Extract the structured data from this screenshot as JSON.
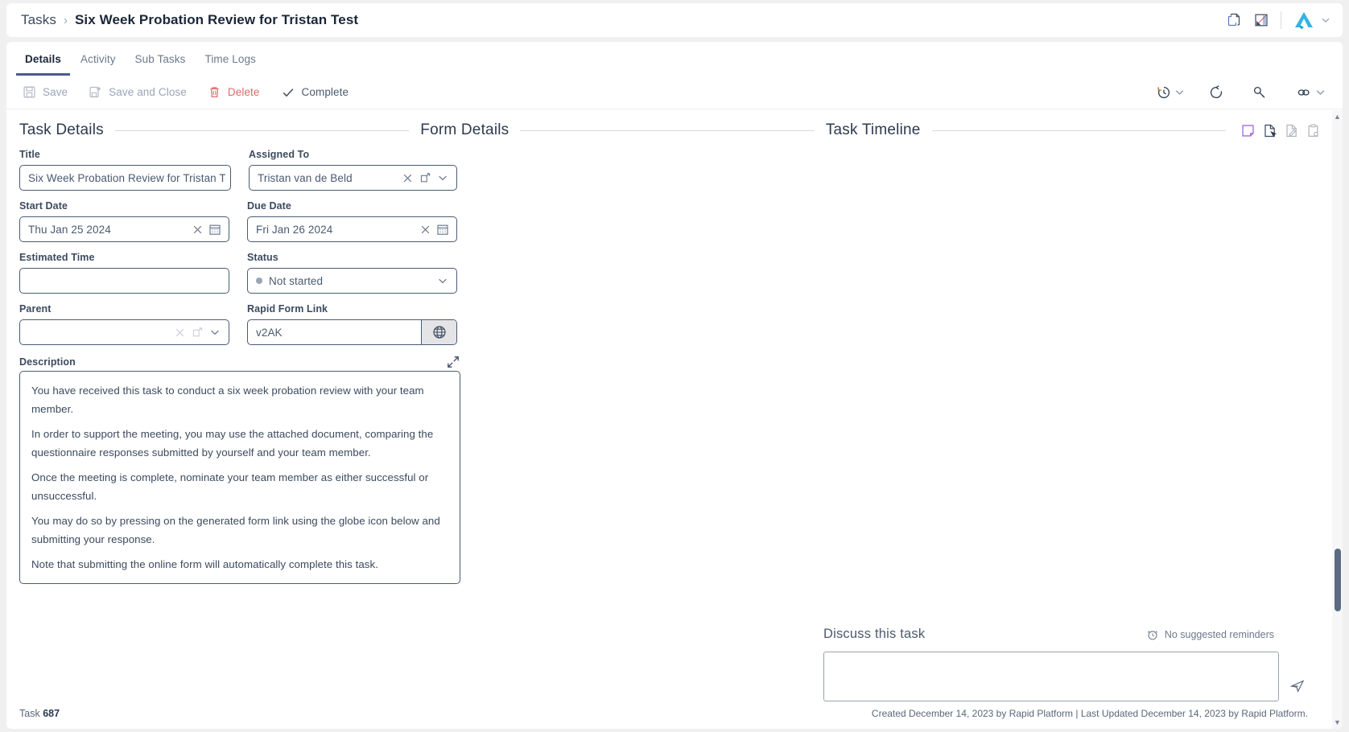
{
  "header": {
    "breadcrumb_root": "Tasks",
    "breadcrumb_separator": "›",
    "breadcrumb_current": "Six Week Probation Review for Tristan Test",
    "icons": [
      "copy-icon",
      "report-ruler-icon",
      "brand-logo",
      "chevron-down-icon"
    ]
  },
  "tabs": [
    {
      "label": "Details",
      "active": true
    },
    {
      "label": "Activity",
      "active": false
    },
    {
      "label": "Sub Tasks",
      "active": false
    },
    {
      "label": "Time Logs",
      "active": false
    }
  ],
  "toolbar": {
    "save_label": "Save",
    "save_and_close_label": "Save and Close",
    "delete_label": "Delete",
    "complete_label": "Complete",
    "right_icons": [
      "history-clock-icon",
      "chevron-down-icon",
      "refresh-icon",
      "key-icon",
      "link-icon",
      "chevron-down-icon"
    ]
  },
  "sections": {
    "task_details": "Task Details",
    "form_details": "Form Details",
    "task_timeline": "Task Timeline",
    "timeline_icons": [
      "note-square-icon",
      "document-pointer-icon",
      "document-edit-icon",
      "clipboard-icon"
    ]
  },
  "fields": {
    "title": {
      "label": "Title",
      "value": "Six Week Probation Review for Tristan Test"
    },
    "assigned_to": {
      "label": "Assigned To",
      "value": "Tristan van de Beld"
    },
    "start_date": {
      "label": "Start Date",
      "value": "Thu Jan 25 2024"
    },
    "due_date": {
      "label": "Due Date",
      "value": "Fri Jan 26 2024"
    },
    "estimated_time": {
      "label": "Estimated Time",
      "value": ""
    },
    "status": {
      "label": "Status",
      "value": "Not started",
      "dot_color": "#9aa5b5"
    },
    "parent": {
      "label": "Parent",
      "value": ""
    },
    "rapid_form_link": {
      "label": "Rapid Form Link",
      "value": "v2AK"
    },
    "description": {
      "label": "Description",
      "lines": [
        "You have received this task to conduct a six week probation review with your team member.",
        "In order to support the meeting, you may use the attached document, comparing the questionnaire responses submitted by yourself and your team member.",
        "Once the meeting is complete, nominate your team member as either successful or unsuccessful.",
        "You may do so by pressing on the generated form link using the globe icon below and submitting your response.",
        "Note that submitting the online form will automatically complete this task."
      ]
    }
  },
  "discuss": {
    "title": "Discuss this task",
    "reminder_text": "No suggested reminders",
    "input_value": "",
    "send_label": "send-icon"
  },
  "footer": {
    "task_prefix": "Task",
    "task_number": "687",
    "audit": "Created December 14, 2023 by Rapid Platform | Last Updated December 14, 2023 by Rapid Platform."
  },
  "colors": {
    "accent": "#4a5b8c",
    "danger": "#e06a6a",
    "brand": "#34b3e4",
    "border": "#4a5b73",
    "purple": "#a06cd5"
  }
}
